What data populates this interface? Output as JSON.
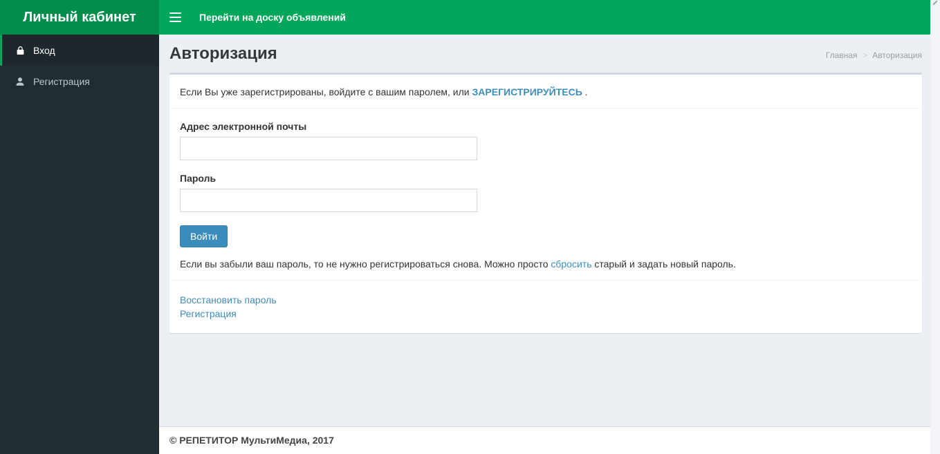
{
  "header": {
    "brand": "Личный кабинет",
    "nav_link": "Перейти на доску объявлений"
  },
  "sidebar": {
    "items": [
      {
        "label": "Вход",
        "icon": "lock-icon",
        "active": true
      },
      {
        "label": "Регистрация",
        "icon": "user-icon",
        "active": false
      }
    ]
  },
  "content": {
    "title": "Авторизация",
    "breadcrumb": {
      "home": "Главная",
      "separator": ">",
      "current": "Авторизация"
    },
    "box": {
      "intro_text": "Если Вы уже зарегистрированы, войдите с вашим паролем, или",
      "intro_link": "ЗАРЕГИСТРИРУЙТЕСЬ",
      "intro_suffix": ".",
      "email_label": "Адрес электронной почты",
      "email_value": "",
      "password_label": "Пароль",
      "password_value": "",
      "submit_label": "Войти",
      "help_text_before": "Если вы забыли ваш пароль, то не нужно регистрироваться снова. Можно просто",
      "help_link": "сбросить",
      "help_text_after": "старый и задать новый пароль.",
      "links": [
        {
          "label": "Восстановить пароль"
        },
        {
          "label": "Регистрация"
        }
      ]
    }
  },
  "footer": {
    "copyright": "© РЕПЕТИТОР МультиМедиа, 2017"
  },
  "colors": {
    "logo_green": "#008d4c",
    "navbar_green": "#00a65a",
    "sidebar_dark": "#222d32",
    "sidebar_active_bg": "#1e282c",
    "content_bg": "#ecf0f5",
    "link_blue": "#3c8dbc",
    "button_blue": "#3c8dbc",
    "input_border": "#d2d6de"
  }
}
